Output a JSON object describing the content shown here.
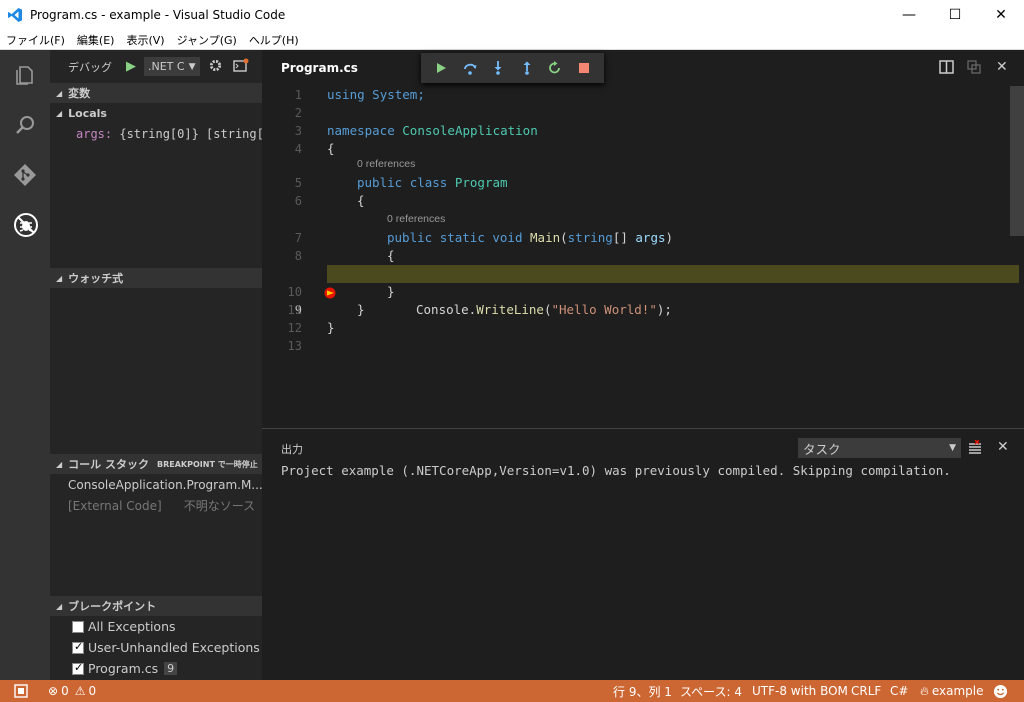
{
  "window": {
    "title": "Program.cs - example - Visual Studio Code",
    "min": "—",
    "max": "☐",
    "close": "✕"
  },
  "menu": [
    "ファイル(F)",
    "編集(E)",
    "表示(V)",
    "ジャンプ(G)",
    "ヘルプ(H)"
  ],
  "sidebar": {
    "header": "デバッグ",
    "config": ".NET C",
    "variables": {
      "title": "変数",
      "scope": "Locals",
      "var_name": "args:",
      "var_value": "{string[0]} [string[…"
    },
    "watch": {
      "title": "ウォッチ式"
    },
    "callstack": {
      "title": "コール スタック",
      "badge": "BREAKPOINT で一時停止",
      "frame1": "ConsoleApplication.Program.M...",
      "frame2_left": "[External Code]",
      "frame2_right": "不明なソース"
    },
    "breakpoints": {
      "title": "ブレークポイント",
      "items": [
        {
          "label": "All Exceptions",
          "checked": false
        },
        {
          "label": "User-Unhandled Exceptions",
          "checked": true
        },
        {
          "label": "Program.cs",
          "checked": true,
          "count": "9"
        }
      ]
    }
  },
  "editor": {
    "tab": "Program.cs",
    "lines": {
      "l1": "1",
      "l2": "2",
      "l3": "3",
      "l4": "4",
      "l5": "5",
      "l6": "6",
      "l7": "7",
      "l8": "8",
      "l9": "9",
      "l10": "10",
      "l11": "11",
      "l12": "12",
      "l13": "13"
    },
    "refs": "0 references",
    "code": {
      "using": "using",
      "system": "System;",
      "namespace": "namespace",
      "ns": "ConsoleApplication",
      "ob": "{",
      "cb": "}",
      "public": "public",
      "class": "class",
      "program": "Program",
      "static": "static",
      "void": "void",
      "main": "Main",
      "lp": "(",
      "string": "string",
      "arr": "[]",
      "args": "args",
      "rp": ")",
      "console": "Console.",
      "writeline": "WriteLine",
      "hello": "\"Hello World!\"",
      "end": ");"
    }
  },
  "panel": {
    "title": "出力",
    "channel": "タスク",
    "output": "Project example (.NETCoreApp,Version=v1.0) was previously compiled. Skipping compilation."
  },
  "status": {
    "errors": "0",
    "warnings": "0",
    "position": "行 9、列 1",
    "spaces": "スペース: 4",
    "encoding": "UTF-8 with BOM",
    "eol": "CRLF",
    "lang": "C#",
    "project": "example"
  },
  "colors": {
    "status": "#cc6633",
    "highlight": "#4b4a1e",
    "breakpoint": "#e51400",
    "debug_green": "#89d185"
  }
}
